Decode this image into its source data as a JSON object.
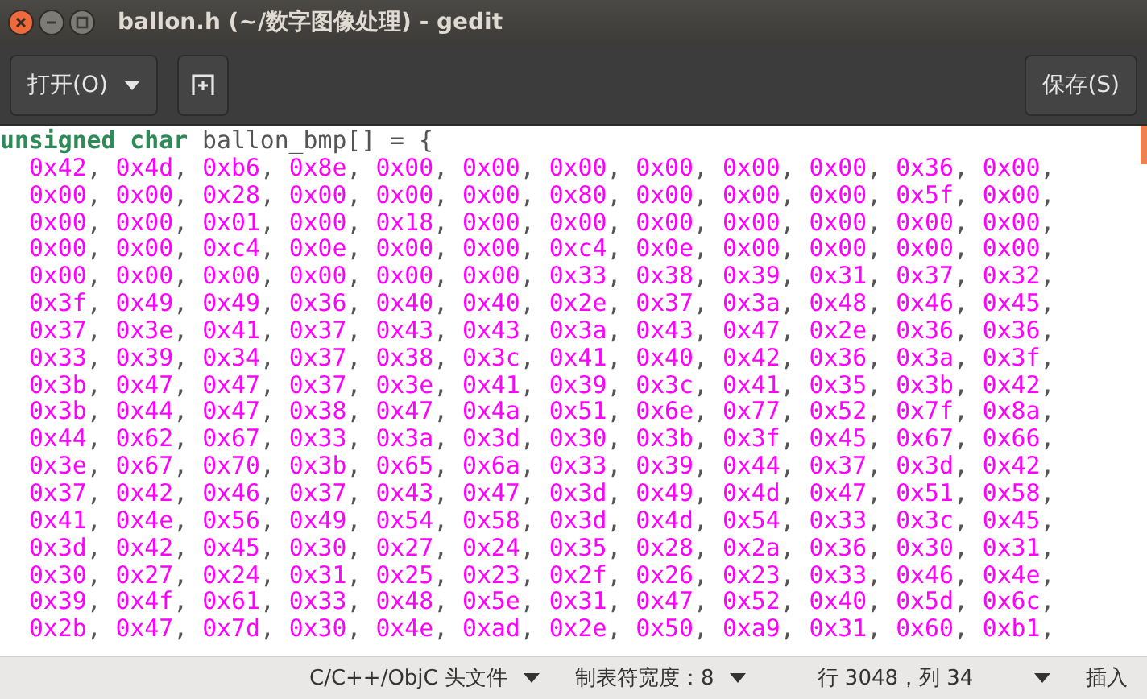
{
  "window": {
    "title": "ballon.h (~/数字图像处理) - gedit"
  },
  "toolbar": {
    "open_button": "打开(O)",
    "save_button": "保存(S)"
  },
  "editor": {
    "lines": [
      {
        "kind": "declaration",
        "keyword": "unsigned char",
        "text": " ballon_bmp[] = {"
      },
      {
        "kind": "data",
        "text": "  0x42, 0x4d, 0xb6, 0x8e, 0x00, 0x00, 0x00, 0x00, 0x00, 0x00, 0x36, 0x00,"
      },
      {
        "kind": "data",
        "text": "  0x00, 0x00, 0x28, 0x00, 0x00, 0x00, 0x80, 0x00, 0x00, 0x00, 0x5f, 0x00,"
      },
      {
        "kind": "data",
        "text": "  0x00, 0x00, 0x01, 0x00, 0x18, 0x00, 0x00, 0x00, 0x00, 0x00, 0x00, 0x00,"
      },
      {
        "kind": "data",
        "text": "  0x00, 0x00, 0xc4, 0x0e, 0x00, 0x00, 0xc4, 0x0e, 0x00, 0x00, 0x00, 0x00,"
      },
      {
        "kind": "data",
        "text": "  0x00, 0x00, 0x00, 0x00, 0x00, 0x00, 0x33, 0x38, 0x39, 0x31, 0x37, 0x32,"
      },
      {
        "kind": "data",
        "text": "  0x3f, 0x49, 0x49, 0x36, 0x40, 0x40, 0x2e, 0x37, 0x3a, 0x48, 0x46, 0x45,"
      },
      {
        "kind": "data",
        "text": "  0x37, 0x3e, 0x41, 0x37, 0x43, 0x43, 0x3a, 0x43, 0x47, 0x2e, 0x36, 0x36,"
      },
      {
        "kind": "data",
        "text": "  0x33, 0x39, 0x34, 0x37, 0x38, 0x3c, 0x41, 0x40, 0x42, 0x36, 0x3a, 0x3f,"
      },
      {
        "kind": "data",
        "text": "  0x3b, 0x47, 0x47, 0x37, 0x3e, 0x41, 0x39, 0x3c, 0x41, 0x35, 0x3b, 0x42,"
      },
      {
        "kind": "data",
        "text": "  0x3b, 0x44, 0x47, 0x38, 0x47, 0x4a, 0x51, 0x6e, 0x77, 0x52, 0x7f, 0x8a,"
      },
      {
        "kind": "data",
        "text": "  0x44, 0x62, 0x67, 0x33, 0x3a, 0x3d, 0x30, 0x3b, 0x3f, 0x45, 0x67, 0x66,"
      },
      {
        "kind": "data",
        "text": "  0x3e, 0x67, 0x70, 0x3b, 0x65, 0x6a, 0x33, 0x39, 0x44, 0x37, 0x3d, 0x42,"
      },
      {
        "kind": "data",
        "text": "  0x37, 0x42, 0x46, 0x37, 0x43, 0x47, 0x3d, 0x49, 0x4d, 0x47, 0x51, 0x58,"
      },
      {
        "kind": "data",
        "text": "  0x41, 0x4e, 0x56, 0x49, 0x54, 0x58, 0x3d, 0x4d, 0x54, 0x33, 0x3c, 0x45,"
      },
      {
        "kind": "data",
        "text": "  0x3d, 0x42, 0x45, 0x30, 0x27, 0x24, 0x35, 0x28, 0x2a, 0x36, 0x30, 0x31,"
      },
      {
        "kind": "data",
        "text": "  0x30, 0x27, 0x24, 0x31, 0x25, 0x23, 0x2f, 0x26, 0x23, 0x33, 0x46, 0x4e,"
      },
      {
        "kind": "data",
        "text": "  0x39, 0x4f, 0x61, 0x33, 0x48, 0x5e, 0x31, 0x47, 0x52, 0x40, 0x5d, 0x6c,"
      },
      {
        "kind": "data",
        "text": "  0x2b, 0x47, 0x7d, 0x30, 0x4e, 0xad, 0x2e, 0x50, 0xa9, 0x31, 0x60, 0xb1,"
      }
    ]
  },
  "status_bar": {
    "language": "C/C++/ObjC 头文件",
    "tab_width": "制表符宽度：8",
    "position": "行 3048，列 34",
    "mode": "插入"
  }
}
